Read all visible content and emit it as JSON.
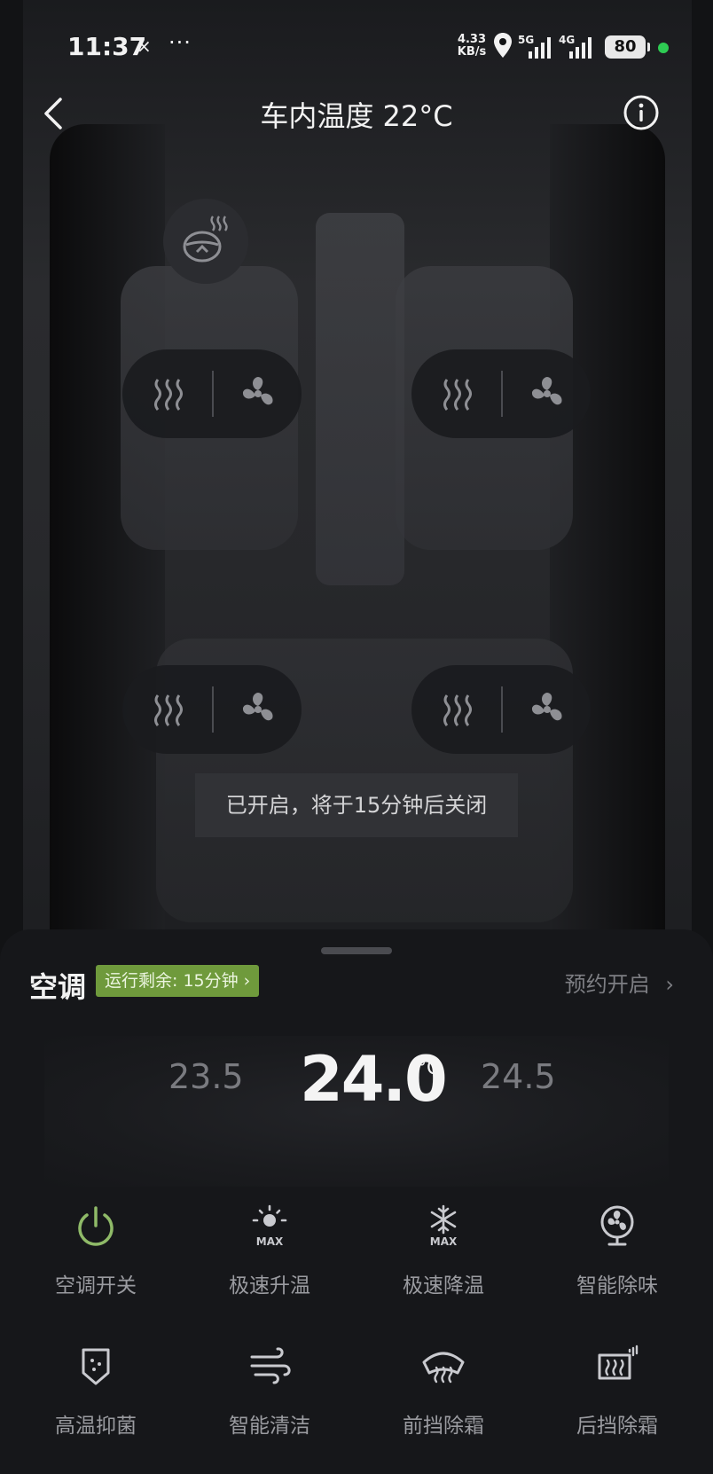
{
  "status_bar": {
    "time": "11:37",
    "x_icon": "×",
    "dots": "···",
    "speed_value": "4.33",
    "speed_unit": "KB/s",
    "net1": "5G",
    "net2": "4G",
    "battery": "80"
  },
  "header": {
    "title": "车内温度 22°C"
  },
  "toast": "已开启，将于15分钟后关闭",
  "climate": {
    "title": "空调",
    "run_badge": "运行剩余: 15分钟",
    "run_badge_chevron": "›",
    "schedule": "预约开启",
    "schedule_chevron": "›",
    "temp_lower": "23.5",
    "temp_current": "24.0",
    "temp_unit": "°C",
    "temp_higher": "24.5"
  },
  "functions": [
    {
      "label": "空调开关",
      "icon": "power-icon"
    },
    {
      "label": "极速升温",
      "icon": "sun-max-icon"
    },
    {
      "label": "极速降温",
      "icon": "snowflake-max-icon"
    },
    {
      "label": "智能除味",
      "icon": "fan-icon"
    },
    {
      "label": "高温抑菌",
      "icon": "shield-icon"
    },
    {
      "label": "智能清洁",
      "icon": "wind-icon"
    },
    {
      "label": "前挡除霜",
      "icon": "front-defrost-icon"
    },
    {
      "label": "后挡除霜",
      "icon": "rear-defrost-icon"
    }
  ],
  "icon_text": {
    "max": "MAX"
  },
  "colors": {
    "accent_green": "#6f9a3c",
    "power_green": "#8fba68",
    "status_dot": "#2ecc53"
  }
}
